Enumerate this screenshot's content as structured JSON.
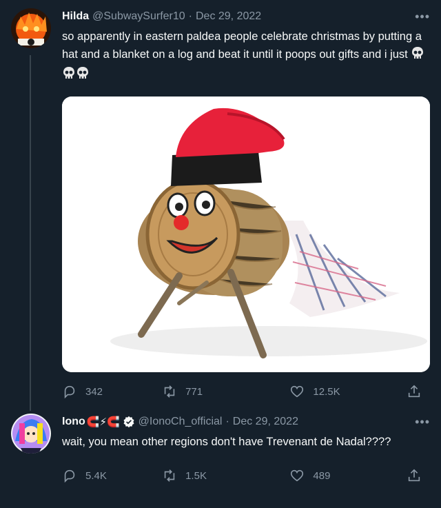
{
  "tweets": [
    {
      "name": "Hilda",
      "handle": "@SubwaySurfer10",
      "separator": "·",
      "date": "Dec 29, 2022",
      "text": "so apparently in eastern paldea people celebrate christmas by putting a hat and a blanket on a log and beat it until it poops out gifts and i just",
      "emoji": [
        "skull",
        "skull",
        "skull"
      ],
      "image": "tió de nadal log with red hat, face and plaid blanket",
      "stats": {
        "replies": "342",
        "retweets": "771",
        "likes": "12.5K"
      }
    },
    {
      "name": "Iono",
      "name_emoji": "🧲⚡🧲",
      "handle": "@IonoCh_official",
      "separator": "·",
      "date": "Dec 29, 2022",
      "text": "wait, you mean other regions don't have Trevenant de Nadal????",
      "stats": {
        "replies": "5.4K",
        "retweets": "1.5K",
        "likes": "489"
      }
    }
  ],
  "colors": {
    "background": "#15202b",
    "text": "#f7f9f9",
    "muted": "#8b98a5",
    "verified": "#1d9bf0",
    "line": "#38444d"
  },
  "icons": [
    "more-icon",
    "reply-icon",
    "retweet-icon",
    "like-icon",
    "share-icon",
    "verified-badge-icon",
    "skull-icon"
  ]
}
